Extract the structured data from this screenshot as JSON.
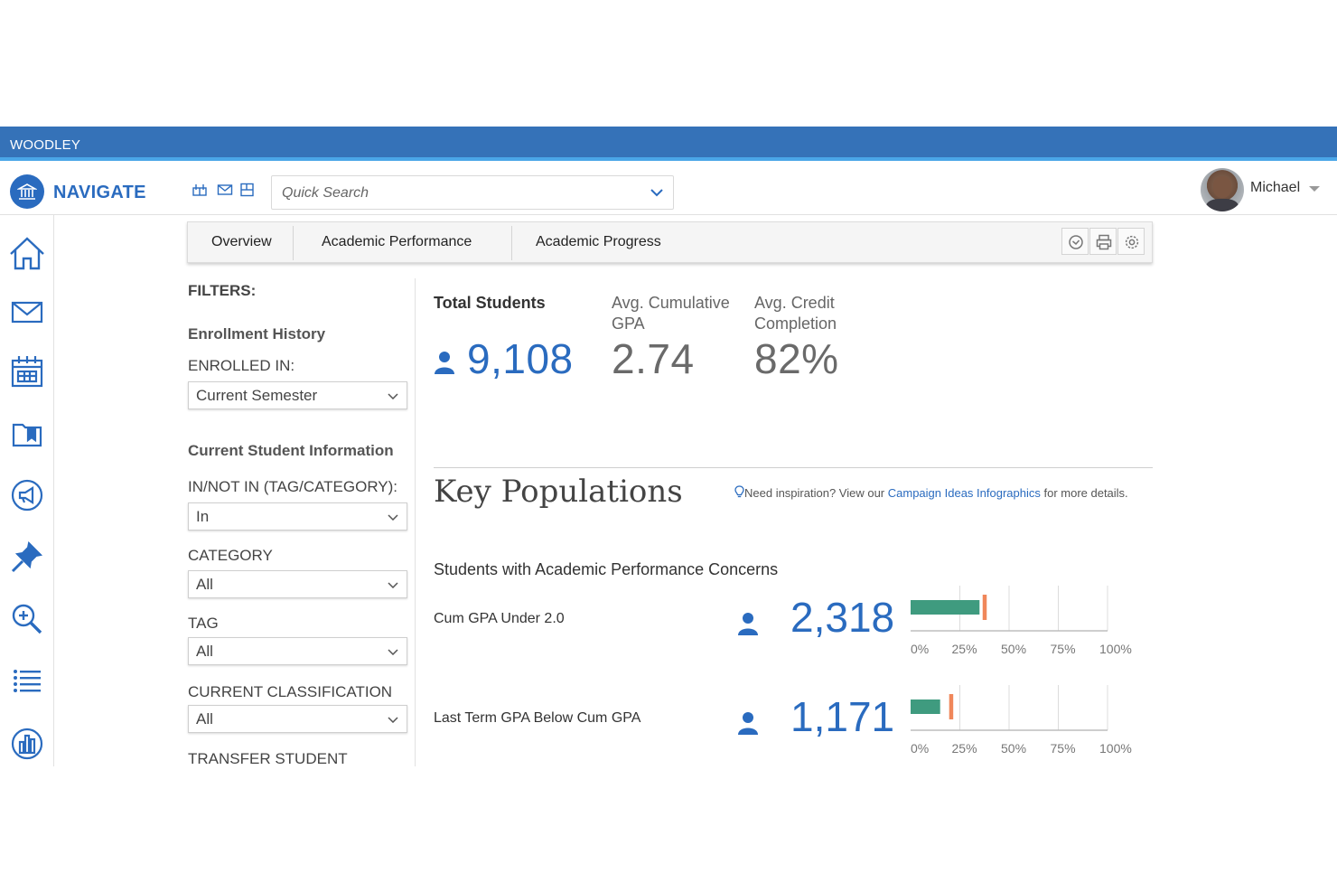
{
  "banner": {
    "org": "WOODLEY"
  },
  "header": {
    "brand": "NAVIGATE",
    "search_placeholder": "Quick Search",
    "user_name": "Michael"
  },
  "tabs": [
    "Overview",
    "Academic Performance",
    "Academic Progress"
  ],
  "filters": {
    "title": "FILTERS:",
    "enrollment_section": "Enrollment History",
    "enrolled_in_label": "ENROLLED IN:",
    "enrolled_in_value": "Current Semester",
    "student_info_section": "Current Student Information",
    "in_not_in_label": "IN/NOT IN (TAG/CATEGORY):",
    "in_not_in_value": "In",
    "category_label": "CATEGORY",
    "category_value": "All",
    "tag_label": "TAG",
    "tag_value": "All",
    "classification_label": "CURRENT CLASSIFICATION",
    "classification_value": "All",
    "transfer_label": "TRANSFER STUDENT"
  },
  "stats": {
    "total_label": "Total Students",
    "total_value": "9,108",
    "gpa_label_1": "Avg. Cumulative",
    "gpa_label_2": "GPA",
    "gpa_value": "2.74",
    "credit_label_1": "Avg. Credit",
    "credit_label_2": "Completion",
    "credit_value": "82%"
  },
  "key_populations": {
    "title": "Key Populations",
    "inspiration_prefix": "Need inspiration? View our ",
    "inspiration_link": "Campaign Ideas Infographics",
    "inspiration_suffix": " for more details.",
    "concerns_title": "Students with Academic Performance Concerns",
    "rows": [
      {
        "label": "Cum GPA Under 2.0",
        "count": "2,318",
        "bar_fraction": 0.35,
        "marker_fraction": 0.375
      },
      {
        "label": "Last Term GPA Below Cum GPA",
        "count": "1,171",
        "bar_fraction": 0.15,
        "marker_fraction": 0.205
      }
    ],
    "axis_ticks": [
      "0%",
      "25%",
      "50%",
      "75%",
      "100%"
    ]
  },
  "colors": {
    "banner": "#3572b8",
    "accent": "#2a6bbf",
    "bar": "#3f9b7f",
    "marker": "#f0875a"
  },
  "icons": [
    "home-icon",
    "mail-icon",
    "calendar-icon",
    "folder-icon",
    "megaphone-icon",
    "pin-icon",
    "search-plus-icon",
    "list-icon",
    "chart-icon"
  ]
}
